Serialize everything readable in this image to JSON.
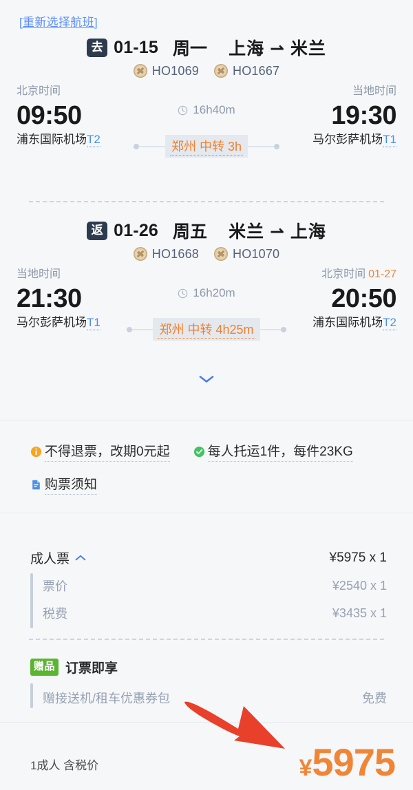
{
  "reselect": {
    "label": "[重新选择航班]"
  },
  "legs": [
    {
      "badge": "去",
      "date": "01-15",
      "weekday": "周一",
      "route": "上海 ⇀ 米兰",
      "flights": [
        {
          "logo": "juneyao-airline-logo",
          "number": "HO1069"
        },
        {
          "logo": "juneyao-airline-logo",
          "number": "HO1667"
        }
      ],
      "depart": {
        "tz_label": "北京时间",
        "next_day": "",
        "time": "09:50",
        "airport": "浦东国际机场",
        "terminal": "T2"
      },
      "duration": "16h40m",
      "transfer": {
        "city": "郑州",
        "text": "中转 3h"
      },
      "arrive": {
        "tz_label": "当地时间",
        "next_day": "",
        "time": "19:30",
        "airport": "马尔彭萨机场",
        "terminal": "T1"
      }
    },
    {
      "badge": "返",
      "date": "01-26",
      "weekday": "周五",
      "route": "米兰 ⇀ 上海",
      "flights": [
        {
          "logo": "juneyao-airline-logo",
          "number": "HO1668"
        },
        {
          "logo": "juneyao-airline-logo",
          "number": "HO1070"
        }
      ],
      "depart": {
        "tz_label": "当地时间",
        "next_day": "",
        "time": "21:30",
        "airport": "马尔彭萨机场",
        "terminal": "T1"
      },
      "duration": "16h20m",
      "transfer": {
        "city": "郑州",
        "text": "中转 4h25m"
      },
      "arrive": {
        "tz_label": "北京时间",
        "next_day": "01-27",
        "time": "20:50",
        "airport": "浦东国际机场",
        "terminal": "T2"
      }
    }
  ],
  "expand": {
    "icon": "chevron-down-icon"
  },
  "policy": {
    "refund": {
      "icon": "info-icon",
      "text": "不得退票，改期0元起"
    },
    "baggage": {
      "icon": "check-circle-icon",
      "text": "每人托运1件，每件23KG"
    },
    "notice": {
      "icon": "document-icon",
      "text": "购票须知"
    }
  },
  "fare": {
    "main": {
      "label": "成人票",
      "toggle_icon": "caret-up-icon",
      "value": "¥5975 x 1"
    },
    "items": [
      {
        "label": "票价",
        "value": "¥2540 x 1"
      },
      {
        "label": "税费",
        "value": "¥3435 x 1"
      }
    ]
  },
  "gift": {
    "badge": "赠品",
    "title": "订票即享",
    "items": [
      {
        "label": "赠接送机/租车优惠券包",
        "value": "免费"
      }
    ]
  },
  "bottom": {
    "summary": "1成人 含税价",
    "currency": "¥",
    "total": "5975"
  },
  "annotation": {
    "icon": "red-arrow-annotation",
    "color": "#e8402a"
  },
  "colors": {
    "background": "#f5f7f9",
    "accent_orange": "#f08536",
    "link_blue": "#5b8ff9",
    "badge_navy": "#2d3b4e",
    "gift_green": "#5bb531",
    "muted": "#8d99ab"
  }
}
